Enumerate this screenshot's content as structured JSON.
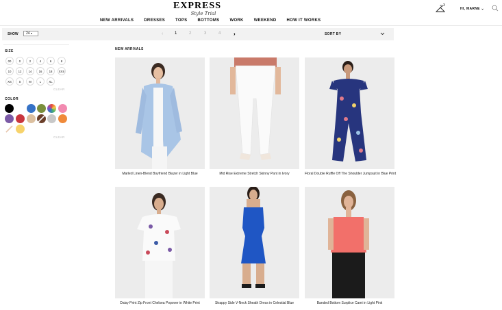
{
  "header": {
    "logo_main": "EXPRESS",
    "logo_sub": "Style Trial",
    "closet_count": "3",
    "greeting": "HI, MARNE",
    "icons": [
      "hanger-icon",
      "search-icon"
    ]
  },
  "nav": {
    "items": [
      "NEW ARRIVALS",
      "DRESSES",
      "TOPS",
      "BOTTOMS",
      "WORK",
      "WEEKEND",
      "HOW IT WORKS"
    ]
  },
  "toolbar": {
    "show_label": "SHOW",
    "show_value": "24",
    "pages": [
      "1",
      "2",
      "3",
      "4"
    ],
    "active_page": "1",
    "sort_label": "SORT BY"
  },
  "filters": {
    "size_title": "SIZE",
    "sizes": [
      "00",
      "0",
      "2",
      "4",
      "6",
      "8",
      "10",
      "12",
      "14",
      "16",
      "18",
      "XXS",
      "XS",
      "S",
      "M",
      "L",
      "XL"
    ],
    "size_clear": "CLEAR",
    "color_title": "COLOR",
    "colors": [
      "#000000",
      "#ffffff",
      "#3572c6",
      "#7a8f3c",
      "multi",
      "#f28ab0",
      "#7b5aa6",
      "#c9363e",
      "#dcc0a0",
      "pattern",
      "#c8c8c8",
      "#f08a3a",
      "nude",
      "#f7d36b"
    ],
    "color_clear": "CLEAR"
  },
  "main": {
    "section_title": "NEW ARRIVALS",
    "products": [
      {
        "name": "Marled Linen-Blend Boyfriend Blazer in Light Blue"
      },
      {
        "name": "Mid Rise Extreme Stretch Skinny Pant in Ivory"
      },
      {
        "name": "Floral Double Ruffle Off The Shoulder Jumpsuit in Blue Print"
      },
      {
        "name": "Daisy Print Zip Front Chelsea Popover in White Print"
      },
      {
        "name": "Strappy Side V-Neck Sheath Dress in Celestial Blue"
      },
      {
        "name": "Banded Bottom Surplice Cami in Light Pink"
      }
    ]
  }
}
